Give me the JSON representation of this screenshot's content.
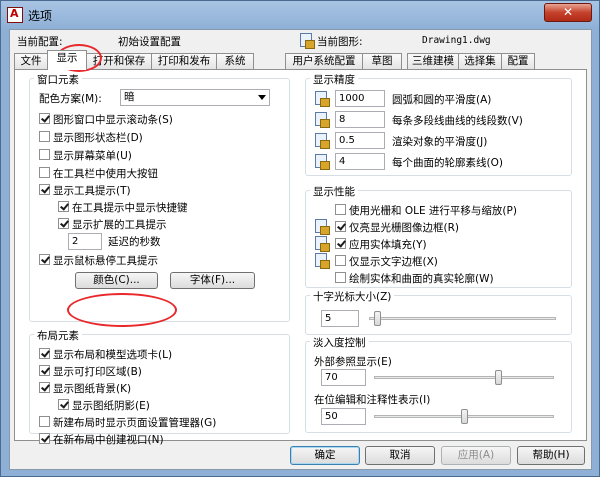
{
  "window": {
    "title": "选项",
    "close_glyph": "✕"
  },
  "header": {
    "profile_label": "当前配置:",
    "profile_value": "初始设置配置",
    "drawing_label": "当前图形:",
    "drawing_value": "Drawing1.dwg"
  },
  "tabs": [
    "文件",
    "显示",
    "打开和保存",
    "打印和发布",
    "系统",
    "用户系统配置",
    "草图",
    "三维建模",
    "选择集",
    "配置"
  ],
  "active_tab": "显示",
  "window_elements": {
    "title": "窗口元素",
    "scheme_label": "配色方案(M):",
    "scheme_value": "暗",
    "checkboxes": [
      {
        "label": "图形窗口中显示滚动条(S)",
        "checked": true
      },
      {
        "label": "显示图形状态栏(D)",
        "checked": false
      },
      {
        "label": "显示屏幕菜单(U)",
        "checked": false
      },
      {
        "label": "在工具栏中使用大按钮",
        "checked": false
      },
      {
        "label": "显示工具提示(T)",
        "checked": true
      },
      {
        "label": "在工具提示中显示快捷键",
        "checked": true
      },
      {
        "label": "显示扩展的工具提示",
        "checked": true
      },
      {
        "label": "显示鼠标悬停工具提示",
        "checked": true
      }
    ],
    "delay_value": "2",
    "delay_label": "延迟的秒数",
    "color_button": "颜色(C)...",
    "font_button": "字体(F)..."
  },
  "layout_elements": {
    "title": "布局元素",
    "checkboxes": [
      {
        "label": "显示布局和模型选项卡(L)",
        "checked": true
      },
      {
        "label": "显示可打印区域(B)",
        "checked": true
      },
      {
        "label": "显示图纸背景(K)",
        "checked": true
      },
      {
        "label": "显示图纸阴影(E)",
        "checked": true
      },
      {
        "label": "新建布局时显示页面设置管理器(G)",
        "checked": false
      },
      {
        "label": "在新布局中创建视口(N)",
        "checked": true
      }
    ]
  },
  "display_resolution": {
    "title": "显示精度",
    "rows": [
      {
        "value": "1000",
        "label": "圆弧和圆的平滑度(A)"
      },
      {
        "value": "8",
        "label": "每条多段线曲线的线段数(V)"
      },
      {
        "value": "0.5",
        "label": "渲染对象的平滑度(J)"
      },
      {
        "value": "4",
        "label": "每个曲面的轮廓素线(O)"
      }
    ]
  },
  "display_performance": {
    "title": "显示性能",
    "checkboxes": [
      {
        "label": "使用光栅和 OLE 进行平移与缩放(P)",
        "checked": false
      },
      {
        "label": "仅亮显光栅图像边框(R)",
        "checked": true
      },
      {
        "label": "应用实体填充(Y)",
        "checked": true
      },
      {
        "label": "仅显示文字边框(X)",
        "checked": false
      },
      {
        "label": "绘制实体和曲面的真实轮廓(W)",
        "checked": false
      }
    ]
  },
  "crosshair": {
    "title": "十字光标大小(Z)",
    "value": "5",
    "slider_level": 0.03
  },
  "fade": {
    "title": "淡入度控制",
    "xref_label": "外部参照显示(E)",
    "xref_value": "70",
    "xref_level": 0.7,
    "inplace_label": "在位编辑和注释性表示(I)",
    "inplace_value": "50",
    "inplace_level": 0.5
  },
  "footer": {
    "ok": "确定",
    "cancel": "取消",
    "apply": "应用(A)",
    "help": "帮助(H)"
  }
}
